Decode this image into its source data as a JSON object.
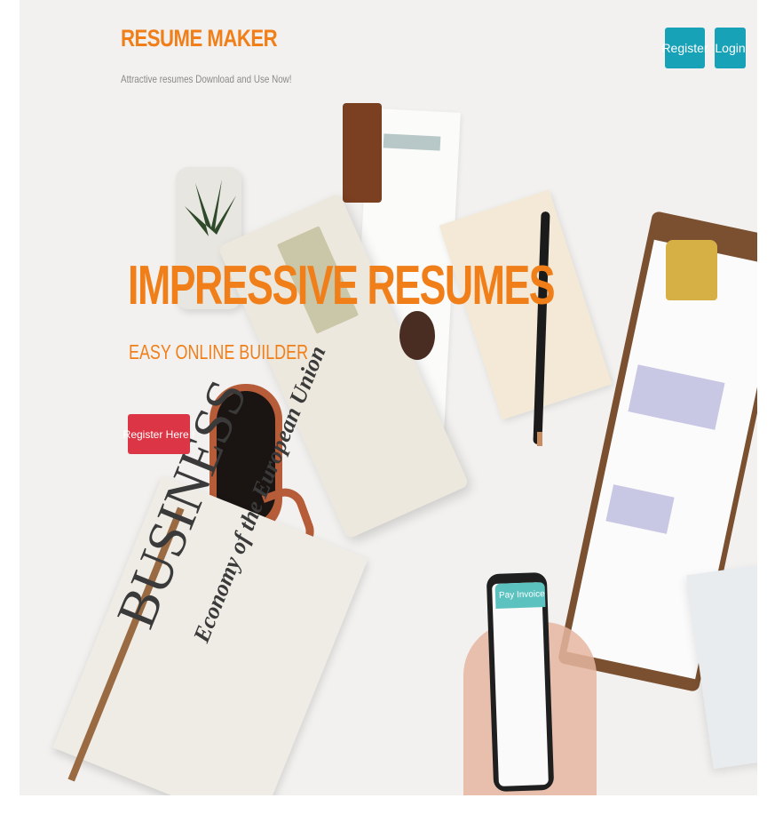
{
  "header": {
    "brand": "RESUME MAKER",
    "tagline": "Attractive resumes Download and Use Now!",
    "register_label": "Register",
    "login_label": "Login"
  },
  "hero": {
    "headline": "IMPRESSIVE RESUMES",
    "subheadline": "EASY ONLINE BUILDER",
    "cta_label": "Register Here !",
    "background_image": "desk-workspace-photo",
    "photo_text": {
      "newspaper_word": "BUSINESS",
      "newspaper_subtitle": "Economy of the European Union",
      "phone_title": "Pay Invoice"
    }
  },
  "colors": {
    "brand": "#f07f1a",
    "nav_button": "#17a2b8",
    "cta_button": "#dc3545"
  }
}
